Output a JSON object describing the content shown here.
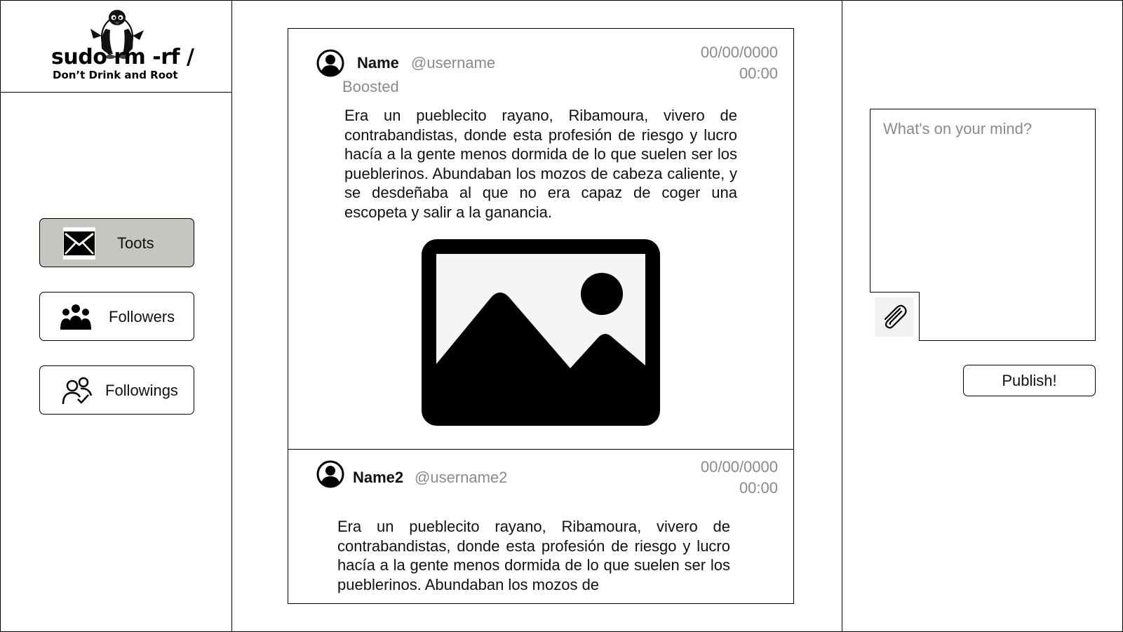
{
  "logo": {
    "title": "sudo rm -rf /",
    "subtitle": "Don’t Drink and Root",
    "mascot_icon": "penguin-icon"
  },
  "nav": {
    "items": [
      {
        "label": "Toots",
        "icon": "envelope-icon",
        "active": true
      },
      {
        "label": "Followers",
        "icon": "group-icon",
        "active": false
      },
      {
        "label": "Followings",
        "icon": "users-check-icon",
        "active": false
      }
    ]
  },
  "feed": {
    "posts": [
      {
        "name": "Name",
        "username": "@username",
        "date": "00/00/0000",
        "time": "00:00",
        "boosted_label": "Boosted",
        "body": "Era un pueblecito rayano, Ribamoura, vivero de contrabandistas, donde esta profesión de riesgo y lucro hacía a la gente menos dormida de lo que suelen ser los pueblerinos. Abundaban los mozos de cabeza caliente, y se desdeñaba al que no era capaz de coger una escopeta y salir a la ganancia.",
        "media_icon": "image-placeholder-icon"
      },
      {
        "name": "Name2",
        "username": "@username2",
        "date": "00/00/0000",
        "time": "00:00",
        "body": "Era un pueblecito rayano, Ribamoura, vivero de contrabandistas, donde esta profesión de riesgo y lucro hacía a la gente menos dormida de lo que suelen ser los pueblerinos. Abundaban los mozos de"
      }
    ]
  },
  "compose": {
    "placeholder": "What's on your mind?",
    "attach_icon": "paperclip-icon",
    "publish_label": "Publish!"
  },
  "colors": {
    "active_nav_bg": "#c6c5c0",
    "muted_text": "#8a8a8a",
    "border": "#000000"
  }
}
